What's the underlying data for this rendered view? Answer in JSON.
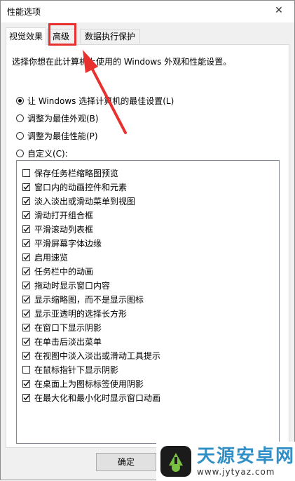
{
  "window": {
    "title": "性能选项",
    "close_glyph": "✕"
  },
  "tabs": [
    {
      "label": "视觉效果",
      "active": true
    },
    {
      "label": "高级",
      "active": false
    },
    {
      "label": "数据执行保护",
      "active": false
    }
  ],
  "visual_effects": {
    "description": "选择你想在此计算机上使用的 Windows 外观和性能设置。",
    "radios": [
      {
        "label": "让 Windows 选择计算机的最佳设置(L)",
        "checked": true
      },
      {
        "label": "调整为最佳外观(B)",
        "checked": false
      },
      {
        "label": "调整为最佳性能(P)",
        "checked": false
      },
      {
        "label": "自定义(C):",
        "checked": false
      }
    ],
    "options": [
      {
        "label": "保存任务栏缩略图预览",
        "checked": false
      },
      {
        "label": "窗口内的动画控件和元素",
        "checked": true
      },
      {
        "label": "淡入淡出或滑动菜单到视图",
        "checked": true
      },
      {
        "label": "滑动打开组合框",
        "checked": true
      },
      {
        "label": "平滑滚动列表框",
        "checked": true
      },
      {
        "label": "平滑屏幕字体边缘",
        "checked": true
      },
      {
        "label": "启用速览",
        "checked": true
      },
      {
        "label": "任务栏中的动画",
        "checked": true
      },
      {
        "label": "拖动时显示窗口内容",
        "checked": true
      },
      {
        "label": "显示缩略图，而不是显示图标",
        "checked": true
      },
      {
        "label": "显示亚透明的选择长方形",
        "checked": true
      },
      {
        "label": "在窗口下显示阴影",
        "checked": true
      },
      {
        "label": "在单击后淡出菜单",
        "checked": true
      },
      {
        "label": "在视图中淡入淡出或滑动工具提示",
        "checked": true
      },
      {
        "label": "在鼠标指针下显示阴影",
        "checked": false
      },
      {
        "label": "在桌面上为图标标签使用阴影",
        "checked": true
      },
      {
        "label": "在最大化和最小化时显示窗口动画",
        "checked": true
      }
    ]
  },
  "buttons": {
    "ok": "确定"
  },
  "annotation": {
    "color": "#e8312f"
  },
  "watermark": {
    "title": "天源安卓网",
    "url": "www.jytyaz.com",
    "color": "#2f8fc6"
  }
}
